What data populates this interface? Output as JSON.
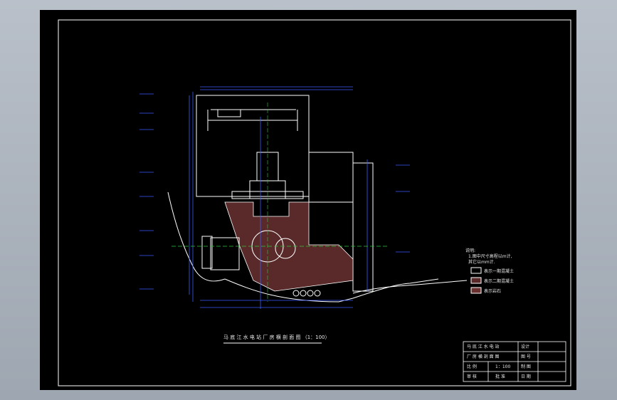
{
  "drawing": {
    "title": "马 底 江 水 电 站 厂 房 横 剖 面 图   （1：100）",
    "colors": {
      "background": "#000000",
      "frame": "#ffffff",
      "dim": "#3a5cff",
      "concrete": "#5a2a2a",
      "ground": "#ffffff",
      "center": "#2ecc40"
    }
  },
  "notes": {
    "heading": "说明:",
    "lines": [
      "1.图中尺寸高程以m计,",
      "  其它以mm计."
    ],
    "legend": [
      {
        "label": "表示一期混凝土",
        "color": "#000000"
      },
      {
        "label": "表示二期混凝土",
        "color": "#5a2a2a"
      },
      {
        "label": "表示岩石",
        "color": "#6a3030"
      }
    ]
  },
  "titleblock": {
    "name_line1": "马 底 江 水 电 站",
    "name_line2": "厂 房 横 剖 面 图",
    "scale_label": "比   例",
    "scale_value": "1：100",
    "design_label": "设计",
    "check_label": "审 核",
    "sheet_no": "图 号",
    "date": "日 期",
    "drawn": "制 图",
    "approve": "批 准"
  }
}
